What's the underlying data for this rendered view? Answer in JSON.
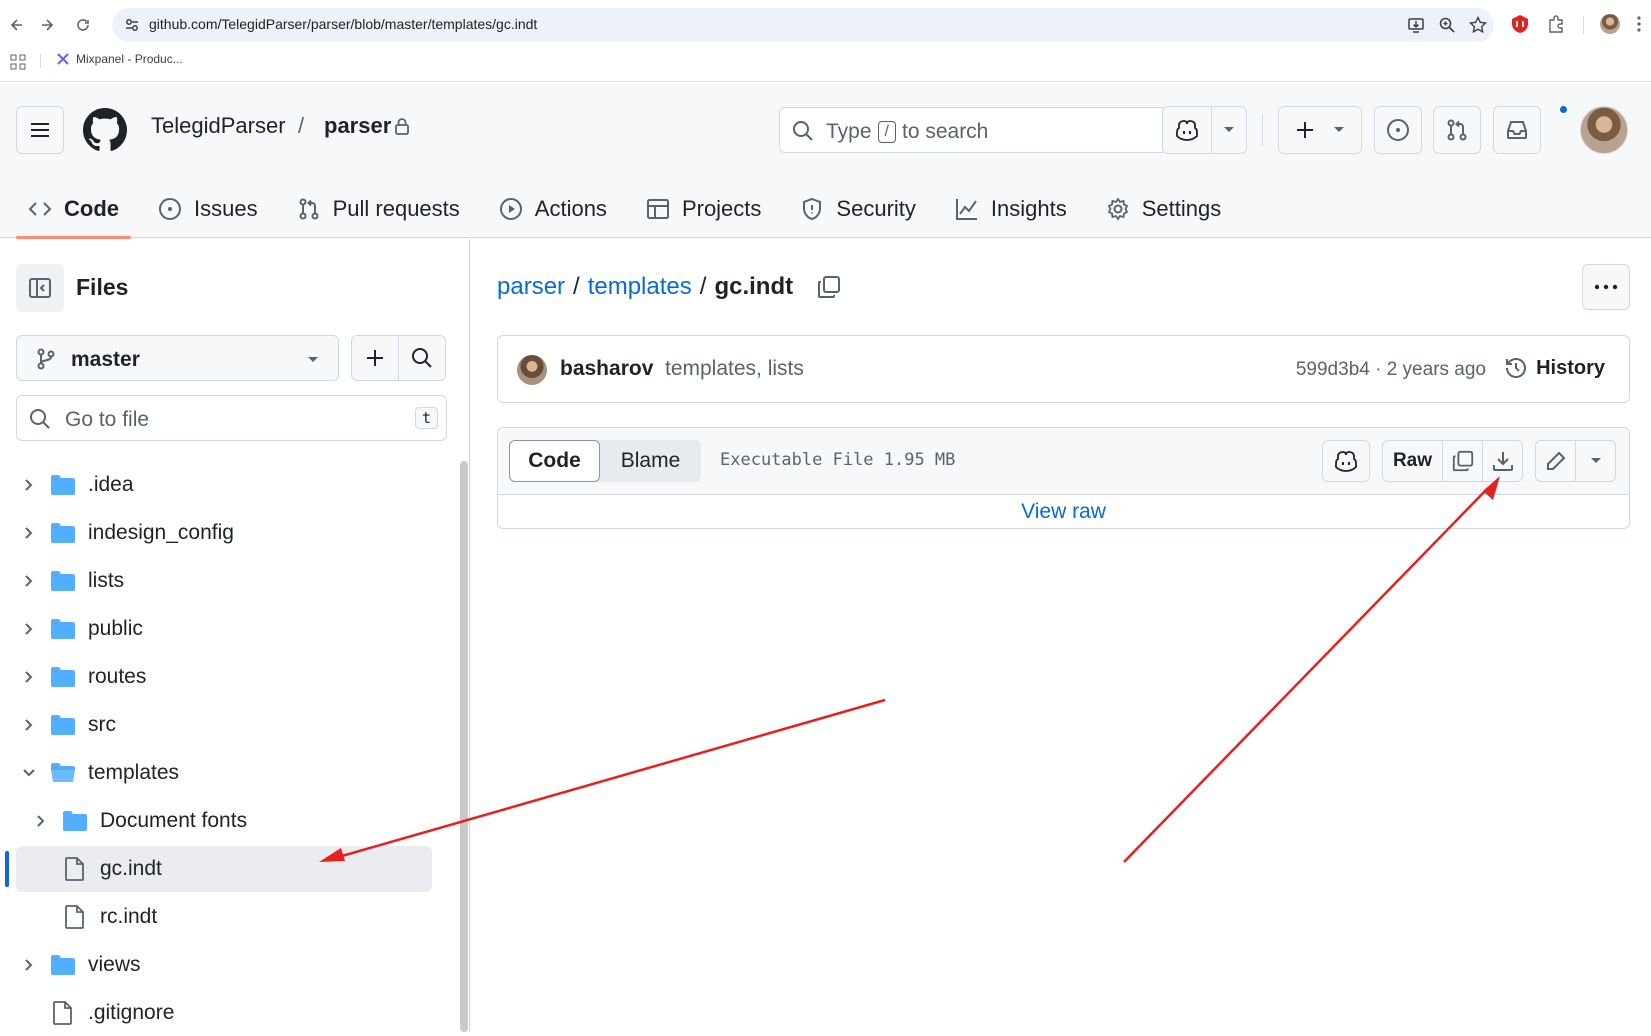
{
  "browser": {
    "url": "github.com/TelegidParser/parser/blob/master/templates/gc.indt",
    "bookmark": "Mixpanel - Produc..."
  },
  "header": {
    "owner": "TelegidParser",
    "separator": "/",
    "repo": "parser",
    "search_prefix": "Type",
    "search_key": "/",
    "search_suffix": "to search"
  },
  "tabs": [
    {
      "label": "Code",
      "icon": "code-icon",
      "active": true
    },
    {
      "label": "Issues",
      "icon": "issue-icon"
    },
    {
      "label": "Pull requests",
      "icon": "pull-request-icon"
    },
    {
      "label": "Actions",
      "icon": "play-icon"
    },
    {
      "label": "Projects",
      "icon": "table-icon"
    },
    {
      "label": "Security",
      "icon": "shield-icon"
    },
    {
      "label": "Insights",
      "icon": "graph-icon"
    },
    {
      "label": "Settings",
      "icon": "gear-icon"
    }
  ],
  "sidebar": {
    "title": "Files",
    "branch": "master",
    "goto_placeholder": "Go to file",
    "goto_key": "t",
    "tree": [
      {
        "name": ".idea",
        "type": "folder",
        "expanded": false,
        "depth": 0
      },
      {
        "name": "indesign_config",
        "type": "folder",
        "expanded": false,
        "depth": 0
      },
      {
        "name": "lists",
        "type": "folder",
        "expanded": false,
        "depth": 0
      },
      {
        "name": "public",
        "type": "folder",
        "expanded": false,
        "depth": 0
      },
      {
        "name": "routes",
        "type": "folder",
        "expanded": false,
        "depth": 0
      },
      {
        "name": "src",
        "type": "folder",
        "expanded": false,
        "depth": 0
      },
      {
        "name": "templates",
        "type": "folder",
        "expanded": true,
        "depth": 0
      },
      {
        "name": "Document fonts",
        "type": "folder",
        "expanded": false,
        "depth": 1
      },
      {
        "name": "gc.indt",
        "type": "file",
        "selected": true,
        "depth": 1
      },
      {
        "name": "rc.indt",
        "type": "file",
        "depth": 1
      },
      {
        "name": "views",
        "type": "folder",
        "expanded": false,
        "depth": 0
      },
      {
        "name": ".gitignore",
        "type": "file",
        "depth": 0
      }
    ]
  },
  "breadcrumb": {
    "root": "parser",
    "sep1": "/",
    "folder": "templates",
    "sep2": "/",
    "file": "gc.indt"
  },
  "commit": {
    "author": "basharov",
    "message": "templates, lists",
    "meta": "599d3b4 · 2 years ago",
    "history_label": "History"
  },
  "file": {
    "tab_code": "Code",
    "tab_blame": "Blame",
    "info": "Executable File 1.95 MB",
    "raw_label": "Raw",
    "view_raw": "View raw"
  },
  "colors": {
    "link": "#0969da",
    "folder": "#54aeff",
    "tab_underline": "#fd8c73",
    "annotation_arrow": "#e5201f"
  }
}
